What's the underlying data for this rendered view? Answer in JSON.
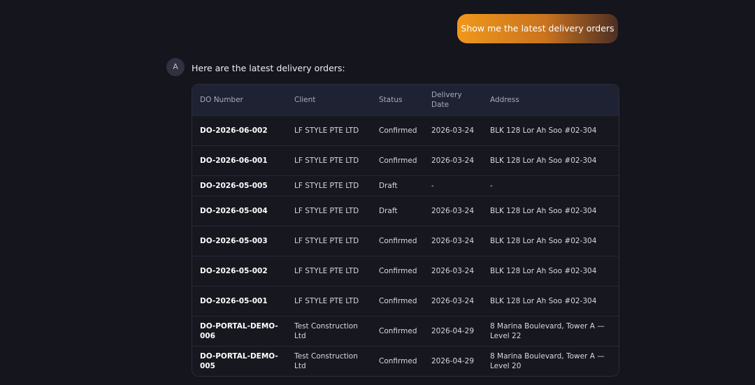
{
  "chat": {
    "user_message": "Show me the latest delivery orders",
    "assistant_avatar": "A",
    "assistant_intro": "Here are the latest delivery orders:"
  },
  "table": {
    "headers": [
      "DO Number",
      "Client",
      "Status",
      "Delivery Date",
      "Address"
    ],
    "rows": [
      [
        "DO-2026-06-002",
        "LF STYLE PTE LTD",
        "Confirmed",
        "2026-03-24",
        "BLK 128 Lor Ah Soo #02-304"
      ],
      [
        "DO-2026-06-001",
        "LF STYLE PTE LTD",
        "Confirmed",
        "2026-03-24",
        "BLK 128 Lor Ah Soo #02-304"
      ],
      [
        "DO-2026-05-005",
        "LF STYLE PTE LTD",
        "Draft",
        "-",
        "-"
      ],
      [
        "DO-2026-05-004",
        "LF STYLE PTE LTD",
        "Draft",
        "2026-03-24",
        "BLK 128 Lor Ah Soo #02-304"
      ],
      [
        "DO-2026-05-003",
        "LF STYLE PTE LTD",
        "Confirmed",
        "2026-03-24",
        "BLK 128 Lor Ah Soo #02-304"
      ],
      [
        "DO-2026-05-002",
        "LF STYLE PTE LTD",
        "Confirmed",
        "2026-03-24",
        "BLK 128 Lor Ah Soo #02-304"
      ],
      [
        "DO-2026-05-001",
        "LF STYLE PTE LTD",
        "Confirmed",
        "2026-03-24",
        "BLK 128 Lor Ah Soo #02-304"
      ],
      [
        "DO-PORTAL-DEMO-006",
        "Test Construction Ltd",
        "Confirmed",
        "2026-04-29",
        "8 Marina Boulevard, Tower A — Level 22"
      ],
      [
        "DO-PORTAL-DEMO-005",
        "Test Construction Ltd",
        "Confirmed",
        "2026-04-29",
        "8 Marina Boulevard, Tower A — Level 20"
      ]
    ]
  },
  "colors": {
    "background": "#14151d",
    "bubble_start": "#f0981c",
    "bubble_end": "#4c2e24",
    "header_bg": "#1e2232"
  }
}
